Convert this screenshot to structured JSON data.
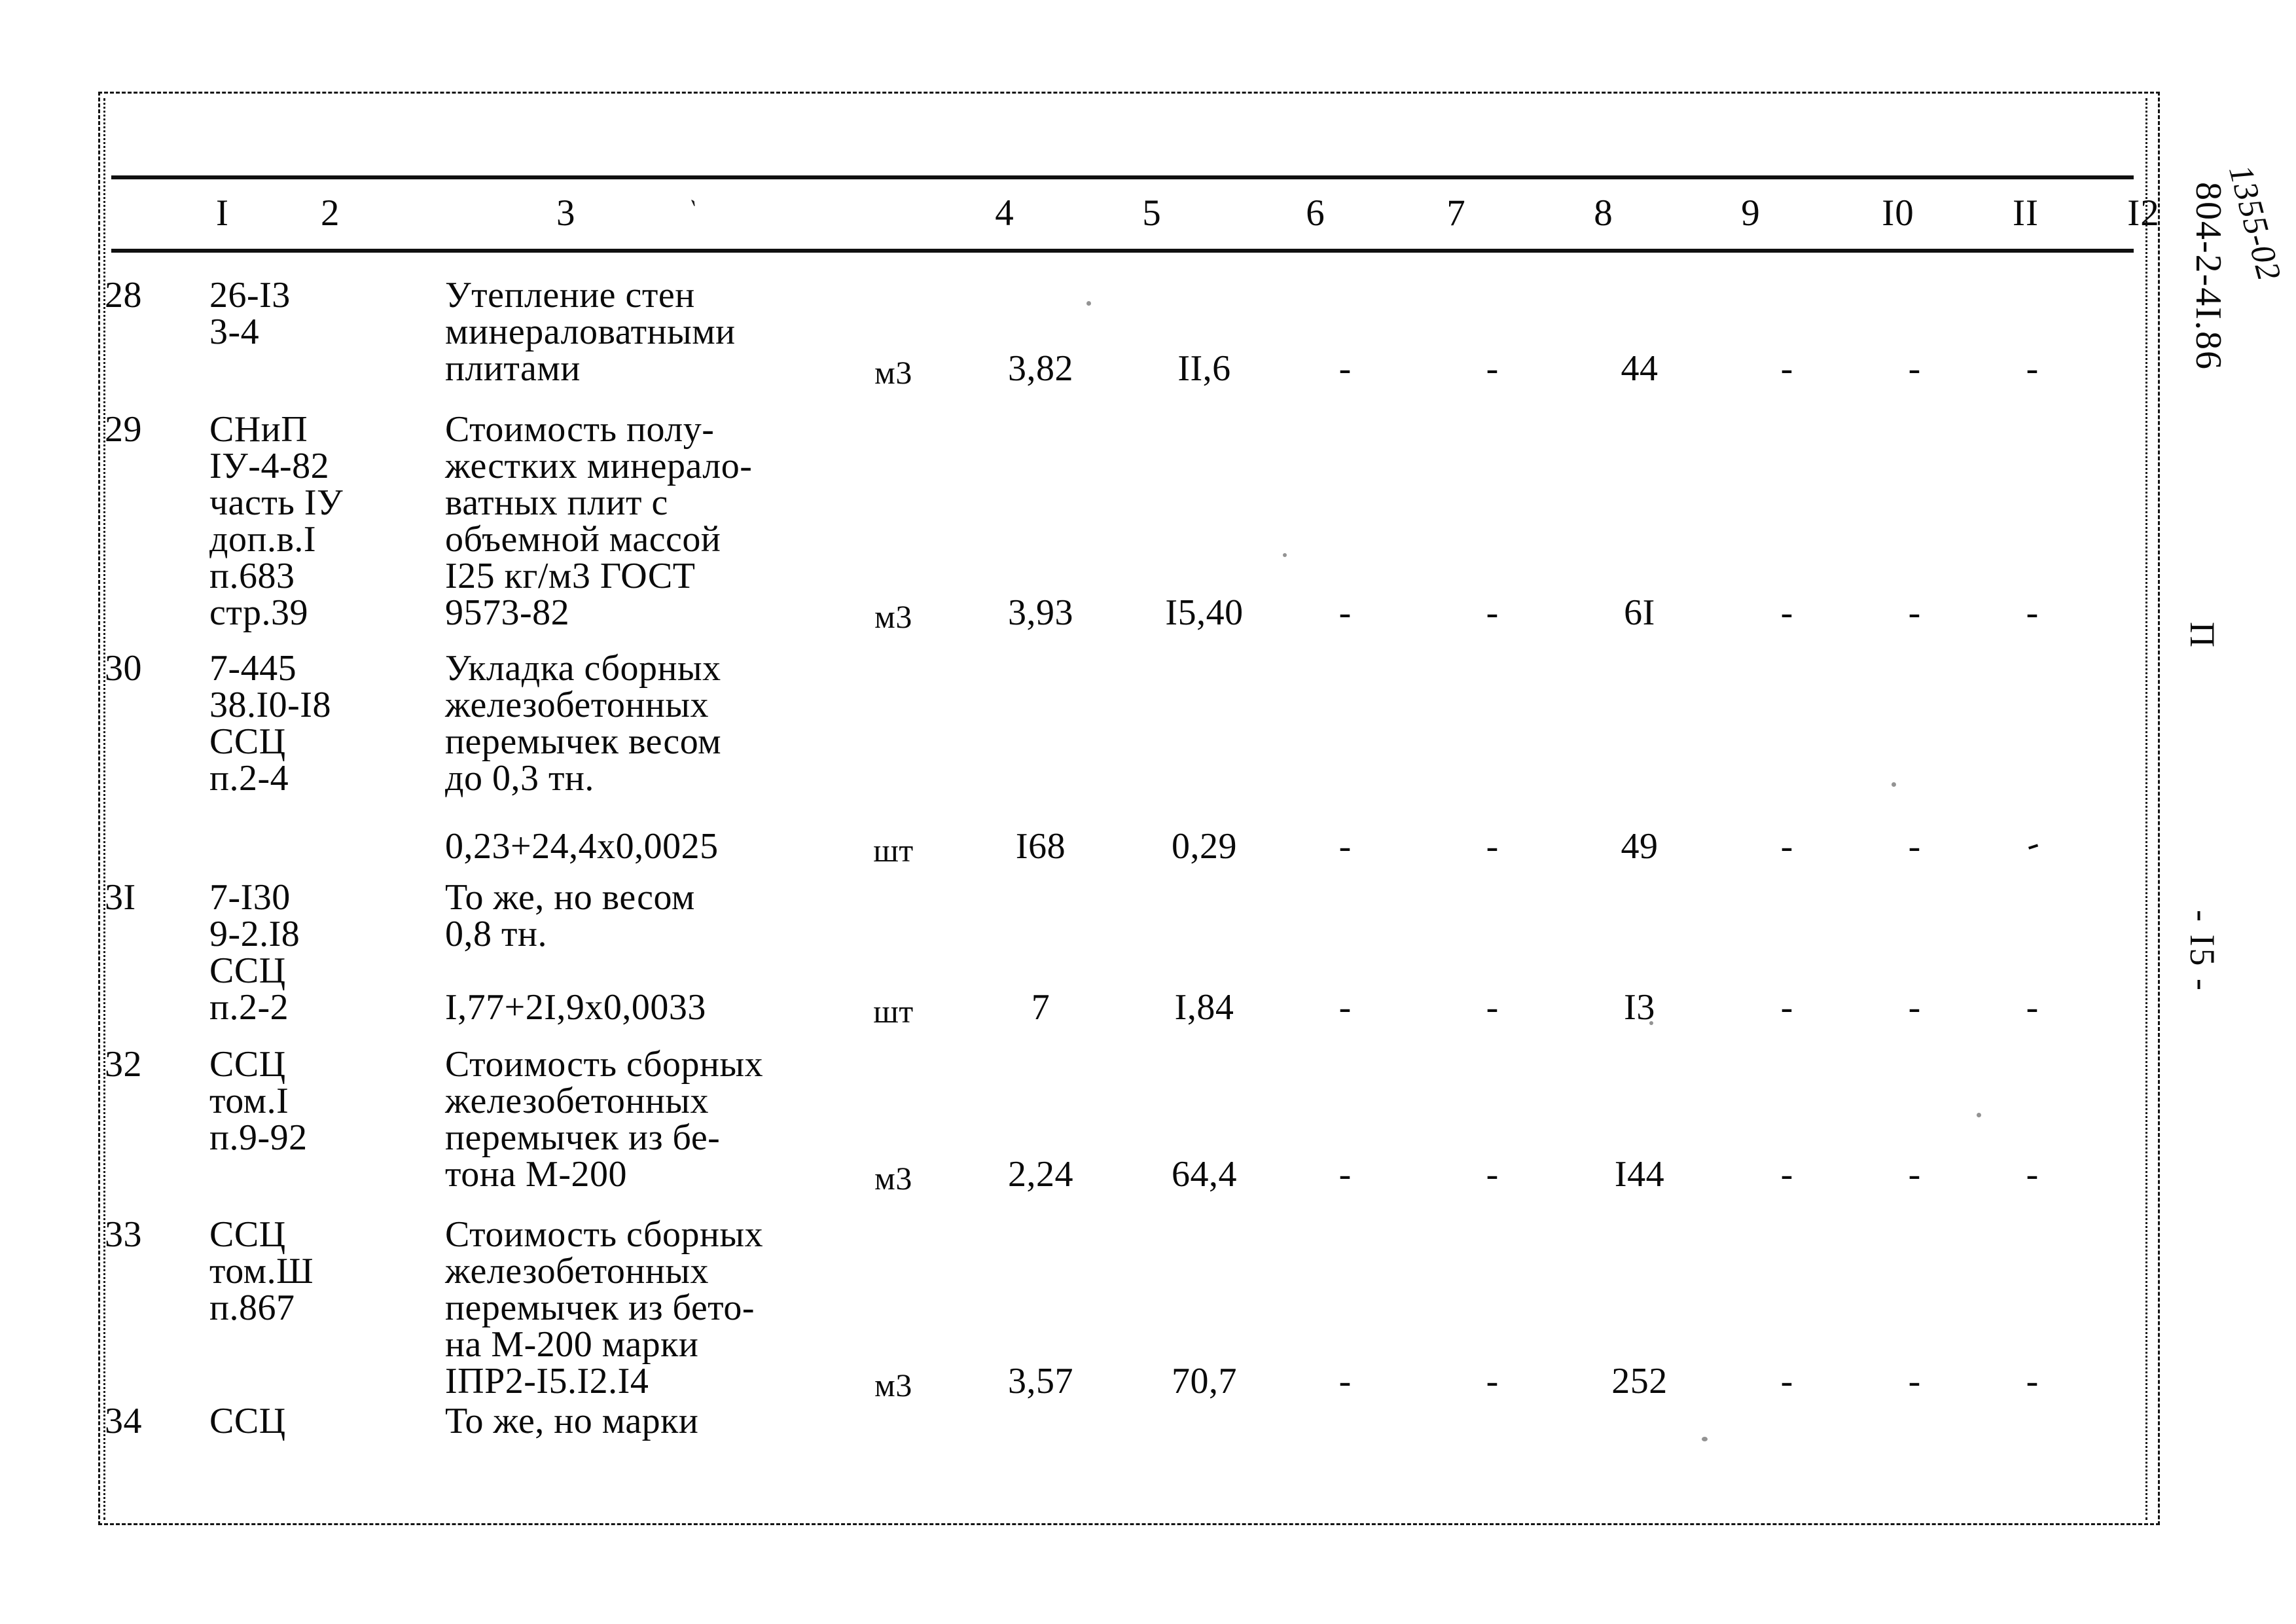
{
  "document": {
    "doc_code": "804-2-4I.86",
    "handwritten_code": "1355-02",
    "section_mark": "П",
    "page_mark": "- I5 -"
  },
  "table": {
    "column_headers": [
      "I",
      "2",
      "3",
      "4",
      "5",
      "6",
      "7",
      "8",
      "9",
      "I0",
      "II",
      "I2"
    ],
    "dash": "-",
    "rows": [
      {
        "num": "28",
        "code_lines": [
          "26-I3",
          "3-4"
        ],
        "desc_lines": [
          "Утепление стен",
          "минераловатными",
          "плитами"
        ],
        "unit": "м3",
        "c5": "3,82",
        "c6": "II,6",
        "c7": "-",
        "c8": "-",
        "c9": "44",
        "c10": "-",
        "c11": "-",
        "c12": "-"
      },
      {
        "num": "29",
        "code_lines": [
          "СНиП",
          "IУ-4-82",
          "часть IУ",
          "доп.в.I",
          "п.683",
          "стр.39"
        ],
        "desc_lines": [
          "Стоимость полу-",
          "жестких минерало-",
          "ватных плит с",
          "объемной массой",
          "I25 кг/м3 ГОСТ",
          "9573-82"
        ],
        "unit": "м3",
        "c5": "3,93",
        "c6": "I5,40",
        "c7": "-",
        "c8": "-",
        "c9": "6I",
        "c10": "-",
        "c11": "-",
        "c12": "-"
      },
      {
        "num": "30",
        "code_lines": [
          "7-445",
          "38.I0-I8",
          "ССЦ",
          "п.2-4"
        ],
        "desc_lines": [
          "Укладка сборных",
          "железобетонных",
          "перемычек весом",
          "до 0,3 тн."
        ],
        "formula": "0,23+24,4х0,0025",
        "unit": "шт",
        "c5": "I68",
        "c6": "0,29",
        "c7": "-",
        "c8": "-",
        "c9": "49",
        "c10": "-",
        "c11": "-",
        "c12": "-"
      },
      {
        "num": "3I",
        "code_lines": [
          "7-I30",
          "9-2.I8",
          "ССЦ",
          "п.2-2"
        ],
        "desc_lines": [
          "То же, но весом",
          "0,8 тн."
        ],
        "formula": "I,77+2I,9х0,0033",
        "unit": "шт",
        "c5": "7",
        "c6": "I,84",
        "c7": "-",
        "c8": "-",
        "c9": "I3",
        "c10": "-",
        "c11": "-",
        "c12": "-"
      },
      {
        "num": "32",
        "code_lines": [
          "ССЦ",
          "том.I",
          "п.9-92"
        ],
        "desc_lines": [
          "Стоимость сборных",
          "железобетонных",
          "перемычек из бе-",
          "тона М-200"
        ],
        "unit": "м3",
        "c5": "2,24",
        "c6": "64,4",
        "c7": "-",
        "c8": "-",
        "c9": "I44",
        "c10": "-",
        "c11": "-",
        "c12": "-"
      },
      {
        "num": "33",
        "code_lines": [
          "ССЦ",
          "том.Ш",
          "п.867"
        ],
        "desc_lines": [
          "Стоимость сборных",
          "железобетонных",
          "перемычек из бето-",
          "на М-200 марки",
          "IПР2-I5.I2.I4"
        ],
        "unit": "м3",
        "c5": "3,57",
        "c6": "70,7",
        "c7": "-",
        "c8": "-",
        "c9": "252",
        "c10": "-",
        "c11": "-",
        "c12": "-"
      },
      {
        "num": "34",
        "code_lines": [
          "ССЦ"
        ],
        "desc_lines": [
          "То же, но марки"
        ],
        "unit": "",
        "c5": "",
        "c6": "",
        "c7": "",
        "c8": "",
        "c9": "",
        "c10": "",
        "c11": "",
        "c12": ""
      }
    ]
  }
}
